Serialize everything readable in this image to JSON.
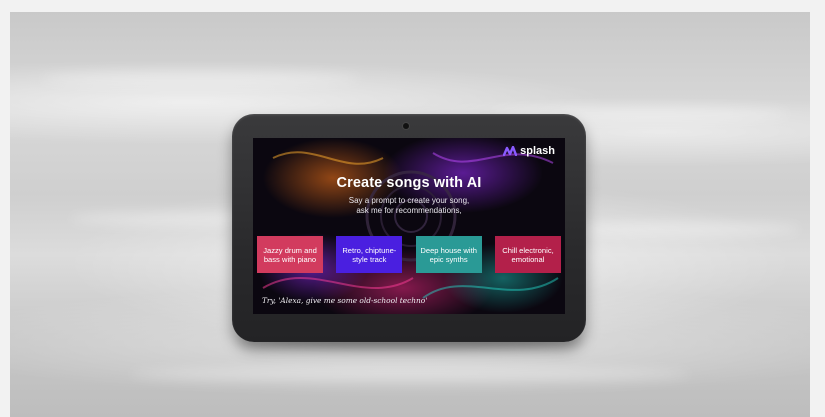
{
  "brand": {
    "name": "splash",
    "logo_icon": "splash-wave-logo"
  },
  "screen": {
    "headline": "Create songs with AI",
    "subline_1": "Say a prompt to create your song,",
    "subline_2": "ask me for recommendations,",
    "chips": [
      {
        "label": "Jazzy drum and bass with piano",
        "color": "#d23b5e"
      },
      {
        "label": "Retro, chiptune-style track",
        "color": "#4a1fe0"
      },
      {
        "label": "Deep house with epic synths",
        "color": "#2a9a96"
      },
      {
        "label": "Chill electronic, emotional",
        "color": "#b3204a"
      }
    ],
    "prompt_hint": "Try, 'Alexa, give me some old-school techno'"
  },
  "colors": {
    "device_body": "#2e2e30",
    "screen_bg": "#0b0710",
    "accent_purple": "#7a3cff"
  }
}
